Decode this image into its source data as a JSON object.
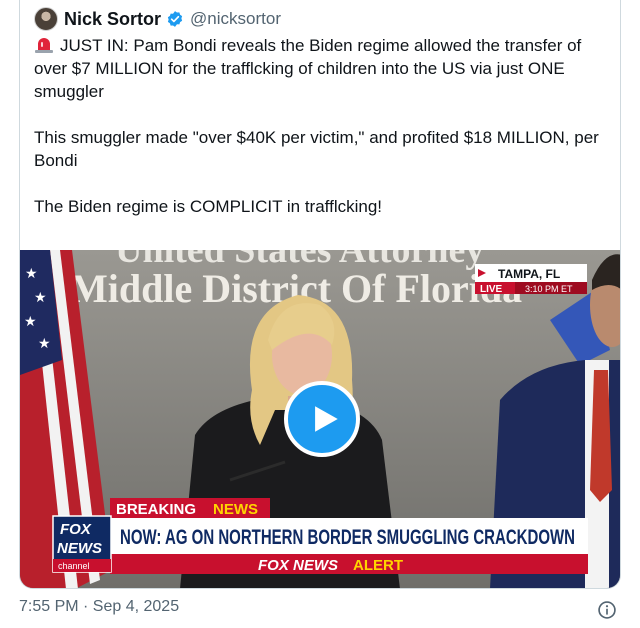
{
  "author": {
    "name": "Nick Sortor",
    "handle": "@nicksortor",
    "verified_color": "#1d9bf0"
  },
  "tweet": {
    "line1": "JUST IN: Pam Bondi reveals the Biden regime allowed the transfer of over $7 MILLION for the trafflcking of children into the US via just ONE smuggler",
    "line2": "This smuggler made \"over $40K per victim,\" and profited $18 MILLION, per Bondi",
    "line3": "The Biden regime is COMPLICIT in trafflcking!",
    "emoji": "siren-emoji"
  },
  "video": {
    "wall_sign_top": "United States Attorney",
    "wall_sign": "Middle District Of Florida",
    "location": "TAMPA, FL",
    "live_label": "LIVE",
    "live_time": "3:10 PM ET",
    "breaking_label_1": "BREAKING",
    "breaking_label_2": "NEWS",
    "headline": "NOW: AG ON NORTHERN BORDER SMUGGLING CRACKDOWN",
    "alert_brand": "FOX NEWS",
    "alert_word": "ALERT",
    "logo_line1": "FOX",
    "logo_line2": "NEWS",
    "logo_line3": "channel",
    "play_icon": "play-icon"
  },
  "footer": {
    "timestamp": "7:55 PM · Sep 4, 2025",
    "info_icon": "info-icon"
  },
  "colors": {
    "accent": "#1d9bf0",
    "banner_red": "#c8102e",
    "headline_bg": "#ffffff",
    "fox_blue": "#0f2a63"
  }
}
